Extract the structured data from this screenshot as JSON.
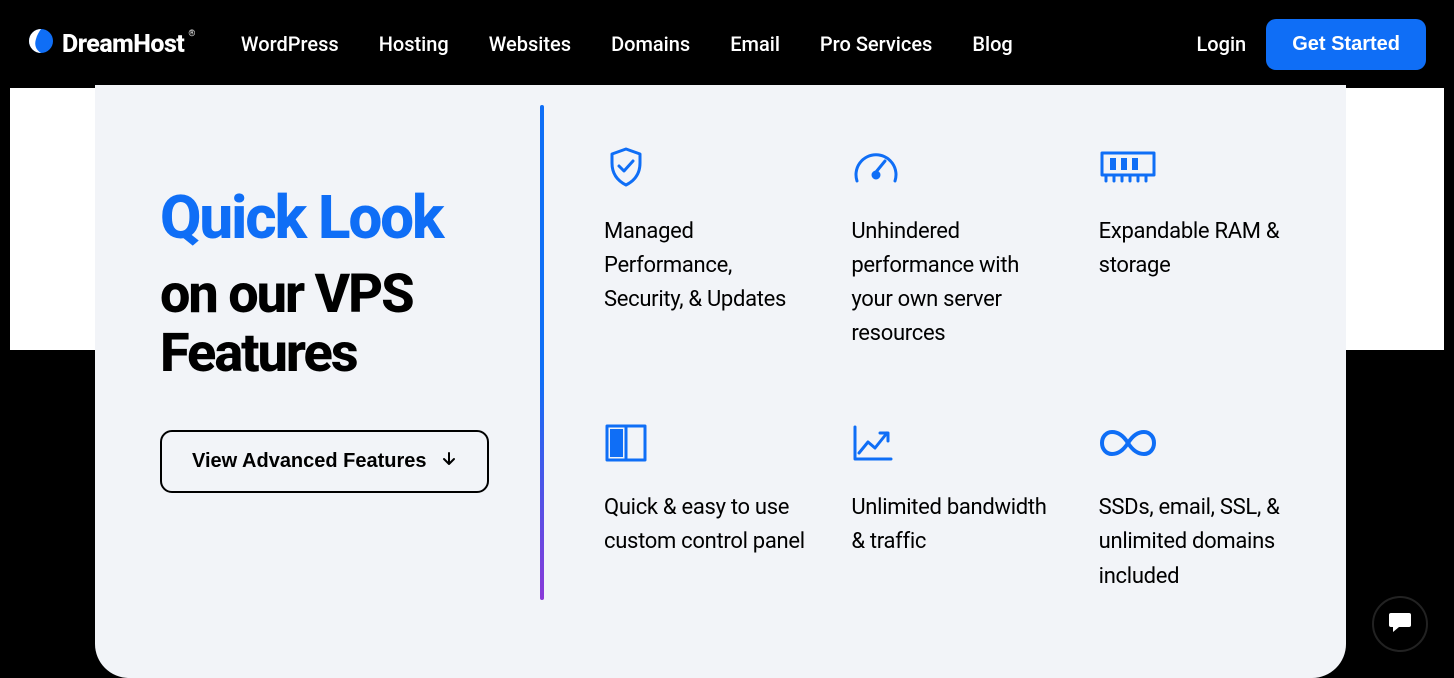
{
  "brand": {
    "name": "DreamHost"
  },
  "nav": {
    "items": [
      "WordPress",
      "Hosting",
      "Websites",
      "Domains",
      "Email",
      "Pro Services",
      "Blog"
    ],
    "login": "Login",
    "cta": "Get Started"
  },
  "hero": {
    "title_line1": "Quick Look",
    "title_line2": "on our VPS",
    "title_line3": "Features",
    "button": "View Advanced Features"
  },
  "features": [
    {
      "icon": "shield-check-icon",
      "text": "Managed Performance, Security, & Updates"
    },
    {
      "icon": "gauge-icon",
      "text": "Unhindered performance with your own server resources"
    },
    {
      "icon": "ram-icon",
      "text": "Expandable RAM & storage"
    },
    {
      "icon": "panels-icon",
      "text": "Quick & easy to use custom control panel"
    },
    {
      "icon": "chart-up-icon",
      "text": "Unlimited bandwidth & traffic"
    },
    {
      "icon": "infinity-icon",
      "text": "SSDs, email, SSL, & unlimited domains included"
    }
  ]
}
